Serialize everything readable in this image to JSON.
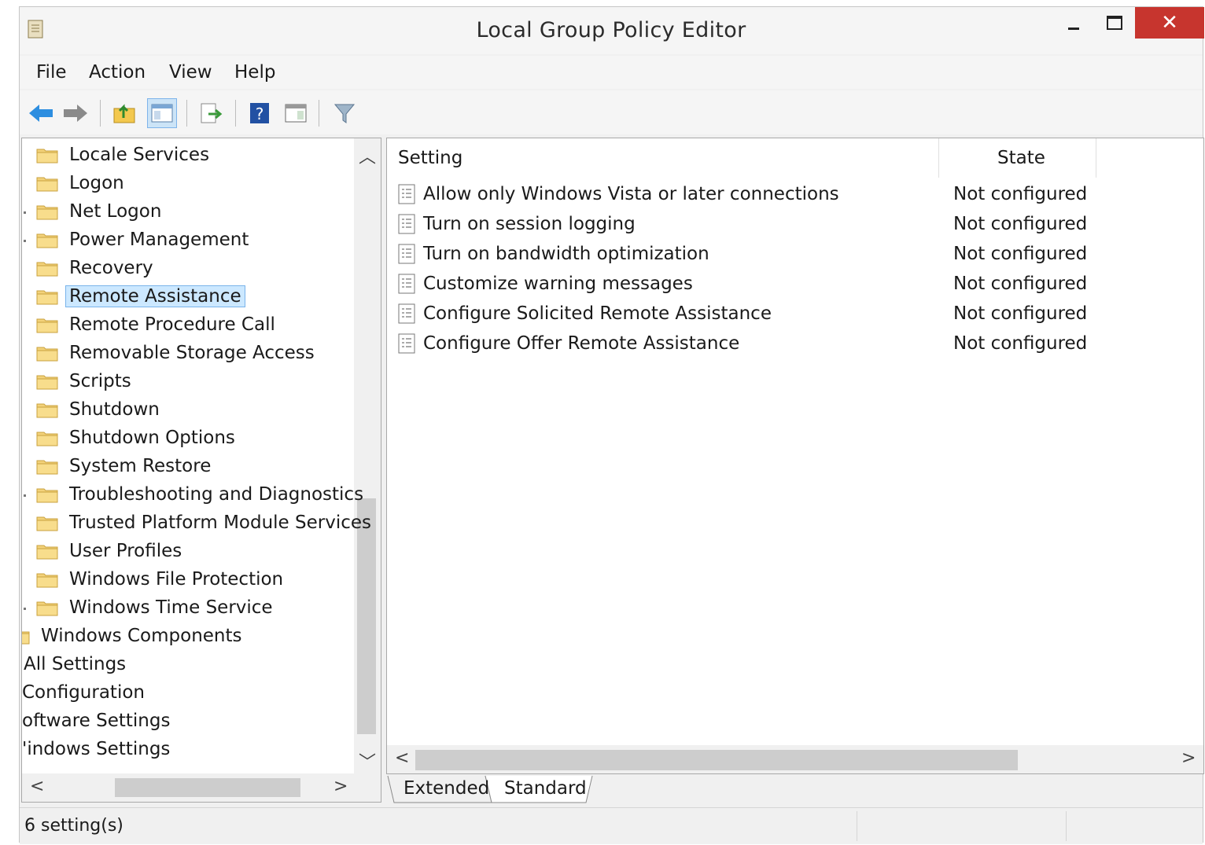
{
  "window": {
    "title": "Local Group Policy Editor"
  },
  "menu": [
    "File",
    "Action",
    "View",
    "Help"
  ],
  "tree": {
    "items": [
      {
        "label": "Locale Services",
        "icon": "folder-icon"
      },
      {
        "label": "Logon",
        "icon": "folder-icon"
      },
      {
        "label": "Net Logon",
        "icon": "folder-icon"
      },
      {
        "label": "Power Management",
        "icon": "folder-icon"
      },
      {
        "label": "Recovery",
        "icon": "folder-icon"
      },
      {
        "label": "Remote Assistance",
        "icon": "folder-icon",
        "selected": true
      },
      {
        "label": "Remote Procedure Call",
        "icon": "folder-icon"
      },
      {
        "label": "Removable Storage Access",
        "icon": "folder-icon"
      },
      {
        "label": "Scripts",
        "icon": "folder-icon"
      },
      {
        "label": "Shutdown",
        "icon": "folder-icon"
      },
      {
        "label": "Shutdown Options",
        "icon": "folder-icon"
      },
      {
        "label": "System Restore",
        "icon": "folder-icon"
      },
      {
        "label": "Troubleshooting and Diagnostics",
        "icon": "folder-icon"
      },
      {
        "label": "Trusted Platform Module Services",
        "icon": "folder-icon"
      },
      {
        "label": "User Profiles",
        "icon": "folder-icon"
      },
      {
        "label": "Windows File Protection",
        "icon": "folder-icon"
      },
      {
        "label": "Windows Time Service",
        "icon": "folder-icon"
      },
      {
        "label": "Windows Components",
        "icon": "folder-icon"
      },
      {
        "label": "All Settings",
        "icon": "settings-page-icon"
      },
      {
        "label": "Configuration",
        "icon": ""
      },
      {
        "label": "oftware Settings",
        "icon": ""
      },
      {
        "label": "'indows Settings",
        "icon": ""
      }
    ]
  },
  "list": {
    "columns": {
      "setting": "Setting",
      "state": "State"
    },
    "rows": [
      {
        "name": "Allow only Windows Vista or later connections",
        "state": "Not configured"
      },
      {
        "name": "Turn on session logging",
        "state": "Not configured"
      },
      {
        "name": "Turn on bandwidth optimization",
        "state": "Not configured"
      },
      {
        "name": "Customize warning messages",
        "state": "Not configured"
      },
      {
        "name": "Configure Solicited Remote Assistance",
        "state": "Not configured"
      },
      {
        "name": "Configure Offer Remote Assistance",
        "state": "Not configured"
      }
    ]
  },
  "tabs": {
    "extended": "Extended",
    "standard": "Standard"
  },
  "status": {
    "text": "6 setting(s)"
  },
  "colors": {
    "close": "#c7352e",
    "selection": "#cce8ff",
    "folder": "#f3d27a"
  }
}
